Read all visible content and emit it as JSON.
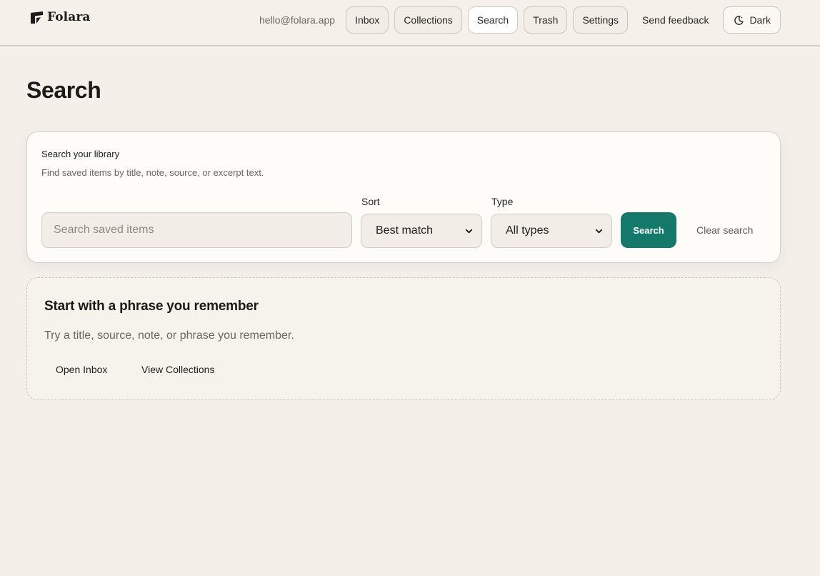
{
  "brand": {
    "name": "Folara"
  },
  "nav": {
    "email": "hello@folara.app",
    "items": [
      {
        "label": "Inbox",
        "active": false
      },
      {
        "label": "Collections",
        "active": false
      },
      {
        "label": "Search",
        "active": true
      },
      {
        "label": "Trash",
        "active": false
      },
      {
        "label": "Settings",
        "active": false
      }
    ],
    "feedback_label": "Send feedback",
    "theme_label": "Dark"
  },
  "page": {
    "title": "Search"
  },
  "search_card": {
    "heading": "Search your library",
    "subtitle": "Find saved items by title, note, source, or excerpt text.",
    "input_value": "",
    "input_placeholder": "Search saved items",
    "sort_label": "Sort",
    "sort_value": "Best match",
    "type_label": "Type",
    "type_value": "All types",
    "search_button": "Search",
    "clear_button": "Clear search"
  },
  "empty_state": {
    "title": "Start with a phrase you remember",
    "text": "Try a title, source, note, or phrase you remember.",
    "open_inbox": "Open Inbox",
    "view_collections": "View Collections"
  },
  "colors": {
    "background": "#f4efe9",
    "accent": "#14786b",
    "card": "#fdfcf9"
  },
  "icons": {
    "brand": "folara-logo-icon",
    "theme": "moon-icon",
    "select": "chevron-down-icon"
  }
}
